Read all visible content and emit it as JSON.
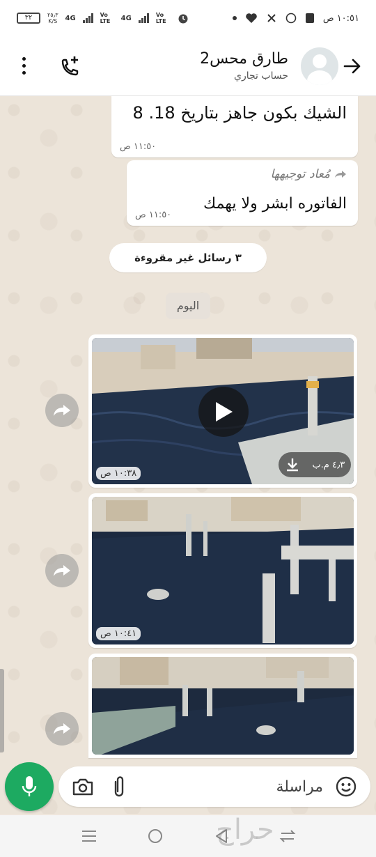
{
  "status_bar": {
    "time": "١٠:٥١ ص",
    "battery": "٣٢",
    "net_speed_value": "٢٥٫٣",
    "net_speed_unit": "K/S",
    "signal1_label": "4G",
    "signal1_sub": "Vo LTE",
    "signal2_label": "4G",
    "signal2_sub": "Vo LTE"
  },
  "header": {
    "contact_name": "طارق محس2",
    "subtitle": "حساب تجاري"
  },
  "messages": [
    {
      "text": "الشيك بكون جاهز بتاريخ 18. 8",
      "time": "١١:٥٠ ص"
    },
    {
      "forwarded_label": "مُعاد توجيهها",
      "text": "الفاتوره ابشر ولا يهمك",
      "time": "١١:٥٠ ص"
    }
  ],
  "unread_label": "٣ رسائل غير مقروءة",
  "date_label": "اليوم",
  "media": [
    {
      "kind": "video",
      "size": "٤٫٣ م.ب",
      "time": "١٠:٣٨ ص"
    },
    {
      "kind": "image",
      "time": "١٠:٤١ ص"
    },
    {
      "kind": "image"
    }
  ],
  "input": {
    "placeholder": "مراسلة"
  },
  "watermark": "حراج",
  "colors": {
    "accent": "#1daa61",
    "bubble": "#ffffff",
    "wallpaper": "#ece4d9"
  },
  "icons": [
    "back-arrow-icon",
    "add-call-icon",
    "more-vert-icon",
    "emoji-icon",
    "attach-icon",
    "camera-icon",
    "mic-icon",
    "play-icon",
    "download-icon",
    "forward-icon"
  ]
}
